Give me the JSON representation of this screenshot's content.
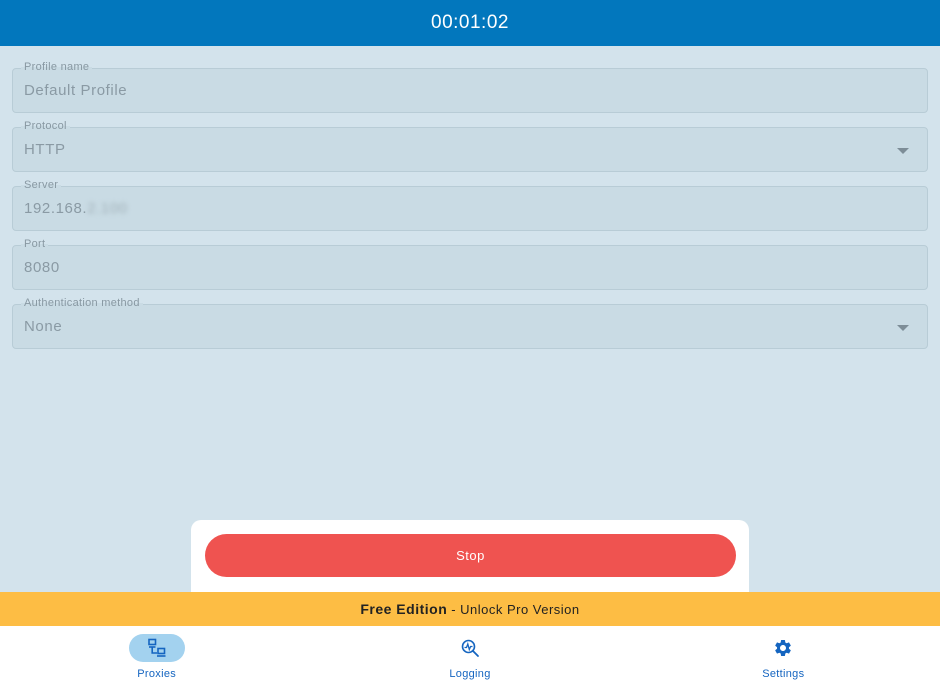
{
  "header": {
    "timer": "00:01:02"
  },
  "form": {
    "profile_name": {
      "label": "Profile name",
      "value": "Default Profile"
    },
    "protocol": {
      "label": "Protocol",
      "value": "HTTP"
    },
    "server": {
      "label": "Server",
      "value_visible": "192.168.",
      "value_blurred": "2.100"
    },
    "port": {
      "label": "Port",
      "value": "8080"
    },
    "auth_method": {
      "label": "Authentication method",
      "value": "None"
    }
  },
  "actions": {
    "stop_label": "Stop"
  },
  "promo": {
    "edition": "Free Edition",
    "separator": "-",
    "unlock": "Unlock Pro Version"
  },
  "nav": {
    "items": [
      {
        "label": "Proxies",
        "icon": "network-icon",
        "active": true
      },
      {
        "label": "Logging",
        "icon": "analytics-search-icon",
        "active": false
      },
      {
        "label": "Settings",
        "icon": "gear-icon",
        "active": false
      }
    ]
  },
  "colors": {
    "header": "#0277bd",
    "background": "#d3e3ec",
    "stop_button": "#ef5350",
    "promo_banner": "#fdbd44",
    "nav_accent": "#1565c0"
  }
}
